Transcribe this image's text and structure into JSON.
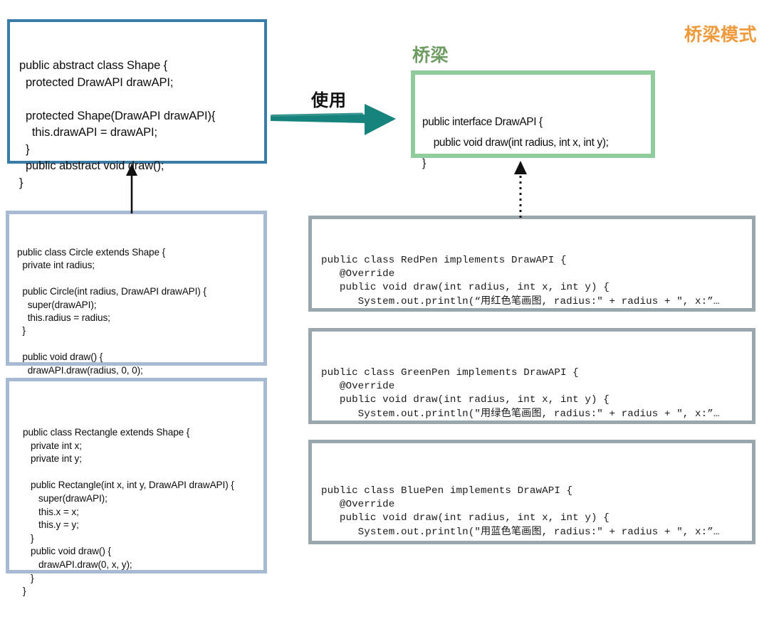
{
  "diagram": {
    "title": "桥梁模式",
    "bridge_label": "桥梁",
    "uses_label": "使用"
  },
  "colors": {
    "title_orange": "#ef9a3c",
    "bridge_green": "#6f9c63",
    "shape_border_blue": "#3a7ca8",
    "subclass_border_blue": "#a8b9d4",
    "interface_border_green": "#8fcb9b",
    "impl_border_gray": "#9aa7ad",
    "arrow_teal": "#16837c",
    "arrow_black": "#111111"
  },
  "boxes": {
    "shape": {
      "name": "Shape",
      "code": "public abstract class Shape {\n  protected DrawAPI drawAPI;\n\n  protected Shape(DrawAPI drawAPI){\n    this.drawAPI = drawAPI;\n  }\n  public abstract void draw();\n}"
    },
    "circle": {
      "name": "Circle",
      "code": "public class Circle extends Shape {\n  private int radius;\n\n  public Circle(int radius, DrawAPI drawAPI) {\n    super(drawAPI);\n    this.radius = radius;\n  }\n\n  public void draw() {\n    drawAPI.draw(radius, 0, 0);\n  }\n}"
    },
    "rectangle": {
      "name": "Rectangle",
      "code": "public class Rectangle extends Shape {\n   private int x;\n   private int y;\n\n   public Rectangle(int x, int y, DrawAPI drawAPI) {\n      super(drawAPI);\n      this.x = x;\n      this.y = y;\n   }\n   public void draw() {\n      drawAPI.draw(0, x, y);\n   }\n}"
    },
    "drawapi": {
      "name": "DrawAPI",
      "code": "public interface DrawAPI {\n    public void draw(int radius, int x, int y);\n}"
    },
    "redpen": {
      "name": "RedPen",
      "code": "public class RedPen implements DrawAPI {\n   @Override\n   public void draw(int radius, int x, int y) {\n      System.out.println(“用红色笔画图, radius:\" + radius + \", x:”…\n   }\n}"
    },
    "greenpen": {
      "name": "GreenPen",
      "code": "public class GreenPen implements DrawAPI {\n   @Override\n   public void draw(int radius, int x, int y) {\n      System.out.println(\"用绿色笔画图, radius:\" + radius + \", x:”…\n   }\n}"
    },
    "bluepen": {
      "name": "BluePen",
      "code": "public class BluePen implements DrawAPI {\n   @Override\n   public void draw(int radius, int x, int y) {\n      System.out.println(\"用蓝色笔画图, radius:\" + radius + \", x:”…\n   }\n}"
    }
  },
  "connectors": {
    "uses_arrow": "thick-teal-right-arrow",
    "inheritance_arrow": "solid-up-arrow",
    "implements_arrow": "dotted-up-arrow"
  }
}
